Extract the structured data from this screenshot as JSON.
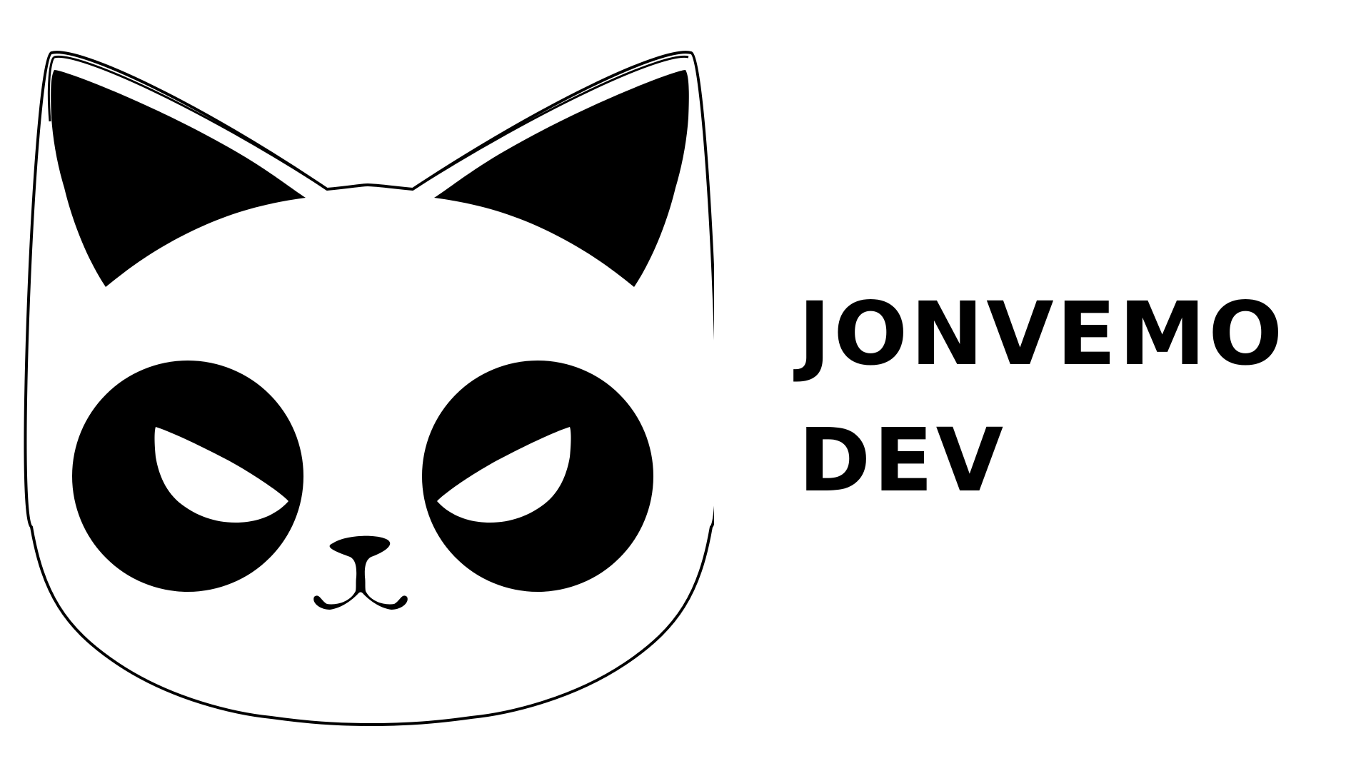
{
  "logo": {
    "icon": "cat-face-icon",
    "colors": {
      "ink": "#000000",
      "paper": "#ffffff"
    }
  },
  "wordmark": {
    "line1": "JONVEMO",
    "line2": "DEV"
  }
}
